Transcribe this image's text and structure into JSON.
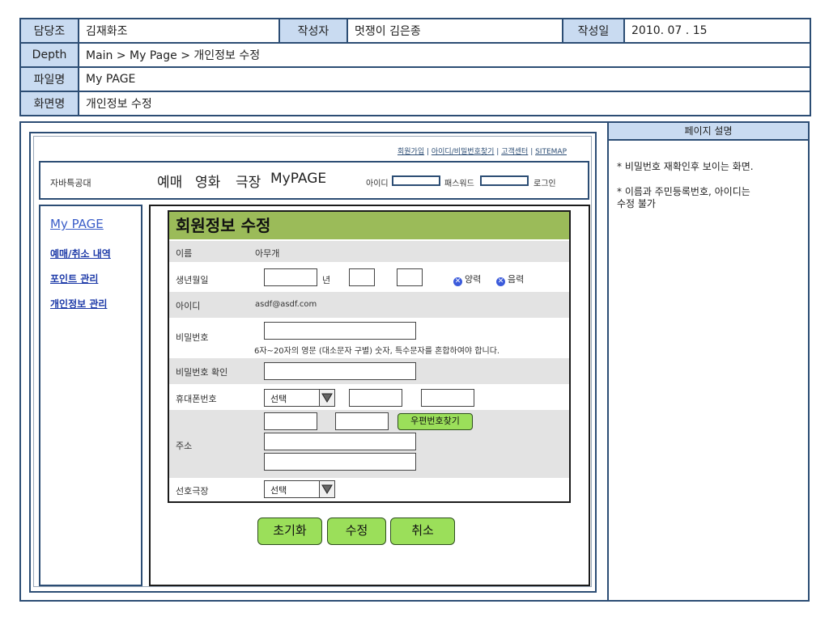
{
  "header": {
    "team_label": "담당조",
    "team_value": "김재화조",
    "author_label": "작성자",
    "author_value": "멋쟁이 김은종",
    "date_label": "작성일",
    "date_value": "2010. 07 . 15",
    "depth_label": "Depth",
    "depth_value": "Main > My Page > 개인정보 수정",
    "file_label": "파일명",
    "file_value": "My PAGE",
    "screen_label": "화면명",
    "screen_value": "개인정보 수정"
  },
  "description": {
    "title": "페이지 설명",
    "notes": [
      "* 비밀번호 재확인후 보이는 화면.",
      "* 이름과 주민등록번호, 아이디는\n  수정 불가"
    ]
  },
  "site": {
    "top_links": [
      "회원가입",
      "아이디/비밀번호찾기",
      "고객센터",
      "SITEMAP"
    ],
    "logo": "자바특공대",
    "nav": [
      "예매",
      "영화",
      "극장",
      "MyPAGE"
    ],
    "id_label": "아이디",
    "pw_label": "패스워드",
    "login_label": "로그인"
  },
  "sidebar": {
    "title": "My PAGE",
    "items": [
      "예매/취소 내역",
      "포인트 관리",
      "개인정보 관리"
    ]
  },
  "form": {
    "title": "회원정보 수정",
    "name_label": "이름",
    "name_value": "아무개",
    "birth_label": "생년월일",
    "year_label": "년",
    "solar_label": "양력",
    "lunar_label": "음력",
    "id_label": "아이디",
    "id_value": "asdf@asdf.com",
    "pw_label": "비밀번호",
    "pw_hint": "6자~20자의 영문 (대소문자 구별) 숫자, 특수문자를 혼합하여야 합니다.",
    "pw_confirm_label": "비밀번호 확인",
    "phone_label": "휴대폰번호",
    "phone_select": "선택",
    "zip_button": "우편번호찾기",
    "address_label": "주소",
    "theater_label": "선호극장",
    "theater_select": "선택"
  },
  "buttons": {
    "reset": "초기화",
    "edit": "수정",
    "cancel": "취소"
  },
  "colors": {
    "border": "#2c4d74",
    "label_bg": "#c9dbf1",
    "title_bg": "#9bbb59",
    "button_bg": "#9bdf5a"
  }
}
